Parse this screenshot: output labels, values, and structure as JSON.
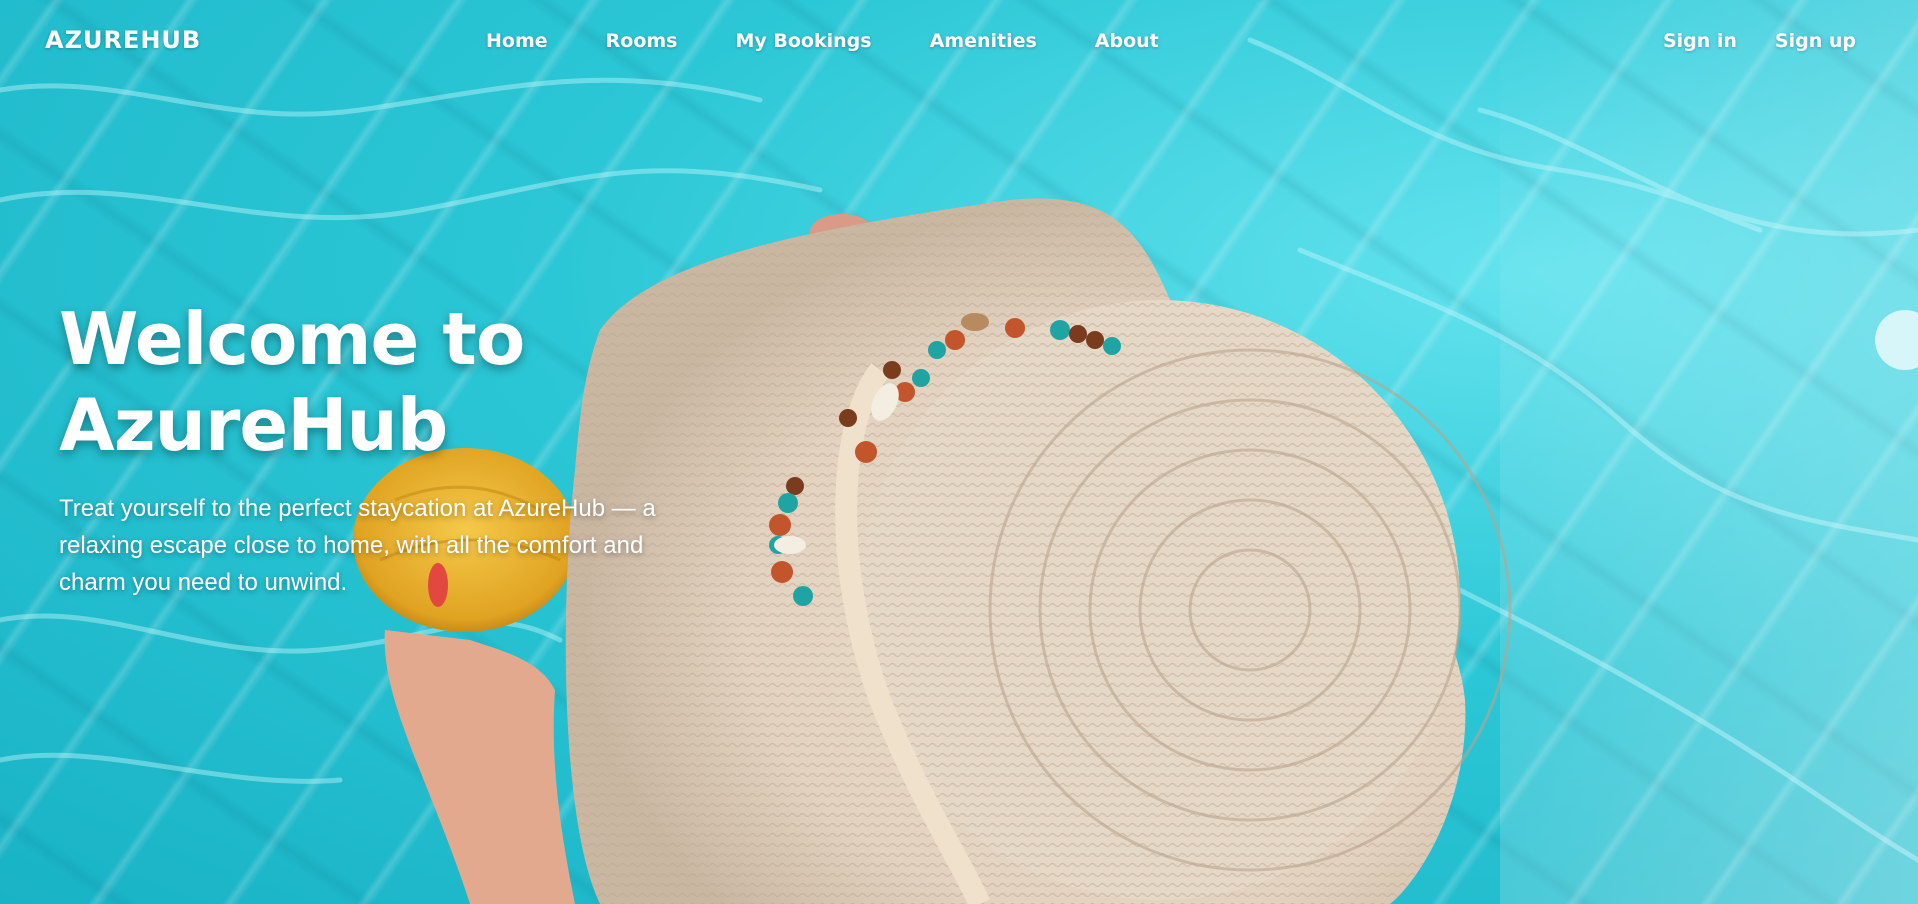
{
  "brand": {
    "name": "AZUREHUB"
  },
  "nav": {
    "items": [
      {
        "label": "Home"
      },
      {
        "label": "Rooms"
      },
      {
        "label": "My Bookings"
      },
      {
        "label": "Amenities"
      },
      {
        "label": "About"
      }
    ]
  },
  "auth": {
    "sign_in": "Sign in",
    "sign_up": "Sign up"
  },
  "hero": {
    "title": "Welcome to AzureHub",
    "subtitle": "Treat yourself to the perfect staycation at AzureHub — a relaxing escape close to home, with all the comfort and charm you need to unwind."
  },
  "theme": {
    "pool_color": "#2cc7d6",
    "text_color": "#ffffff"
  }
}
